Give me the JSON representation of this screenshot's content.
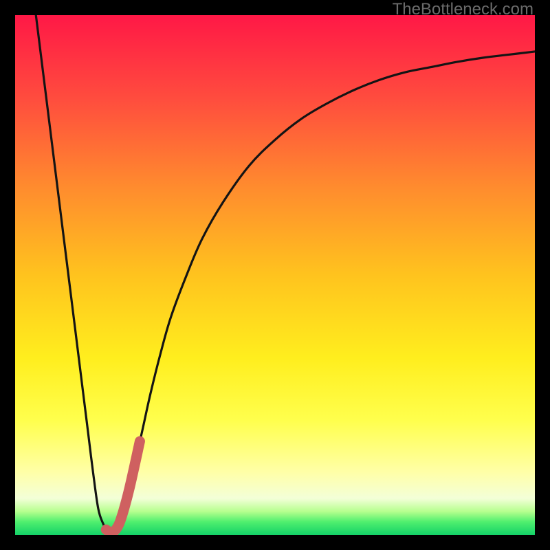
{
  "watermark": "TheBottleneck.com",
  "colors": {
    "frame_bg": "#000000",
    "gradient_top": "#ff1846",
    "gradient_mid_upper": "#ff7a2e",
    "gradient_mid": "#ffd21c",
    "gradient_lower": "#ffff4d",
    "gradient_pale": "#ffffc7",
    "gradient_green1": "#8dff6a",
    "gradient_green2": "#18e06e",
    "curve_stroke": "#141414",
    "accent_stroke": "#cf6060"
  },
  "chart_data": {
    "type": "line",
    "title": "",
    "xlabel": "",
    "ylabel": "",
    "xlim": [
      0,
      100
    ],
    "ylim": [
      0,
      100
    ],
    "grid": false,
    "legend": false,
    "series": [
      {
        "name": "bottleneck-curve",
        "color": "#141414",
        "x": [
          4,
          5,
          6,
          7,
          8,
          9,
          10,
          11,
          12,
          13,
          14,
          15,
          16,
          17,
          18,
          20,
          22,
          24,
          26,
          28,
          30,
          33,
          36,
          40,
          45,
          50,
          55,
          60,
          65,
          70,
          75,
          80,
          85,
          90,
          95,
          100
        ],
        "y": [
          100,
          92,
          84,
          76,
          68,
          60,
          52,
          44,
          36,
          28,
          20,
          12,
          5,
          2,
          0,
          3,
          10,
          18,
          27,
          35,
          42,
          50,
          57,
          64,
          71,
          76,
          80,
          83,
          85.5,
          87.5,
          89,
          90,
          91,
          91.8,
          92.4,
          93
        ]
      },
      {
        "name": "accent-segment",
        "color": "#cf6060",
        "x": [
          17.5,
          18.5,
          19.5,
          20.5,
          22,
          24
        ],
        "y": [
          1,
          0.5,
          1.2,
          3.5,
          9,
          18
        ]
      }
    ],
    "annotations": [
      {
        "text": "TheBottleneck.com",
        "position": "top-right"
      }
    ]
  }
}
